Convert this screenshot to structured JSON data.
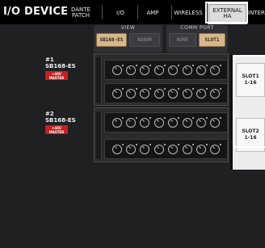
{
  "header": {
    "title": "I/O DEVICE",
    "tabs": [
      {
        "label": "DANTE\nPATCH"
      },
      {
        "label": "I/O"
      },
      {
        "label": "AMP"
      },
      {
        "label": "WIRELESS"
      },
      {
        "label": "EXTERNAL\nHA",
        "selected": true
      },
      {
        "label": "INTERN"
      }
    ]
  },
  "view": {
    "label": "VIEW",
    "options": [
      "SB168-ES",
      "AD8HR"
    ],
    "selected": "SB168-ES"
  },
  "comm_port": {
    "label": "COMM PORT",
    "options": [
      "NONE",
      "SLOT1"
    ],
    "selected": "SLOT1"
  },
  "devices": [
    {
      "id": "#1",
      "model": "SB168-ES",
      "badge": "+48V\nMASTER"
    },
    {
      "id": "#2",
      "model": "SB168-ES",
      "badge": "+48V\nMASTER"
    }
  ],
  "slots": [
    {
      "label": "SLOT1\n1-16"
    },
    {
      "label": "SLOT2\n1-16"
    }
  ],
  "colors": {
    "background": "#1f2022",
    "header": "#000000",
    "selected_button": "#d8b88b",
    "badge_red": "#c81e1e",
    "selected_tab": "#dcdcdc"
  },
  "icons": [
    "knob-icon"
  ]
}
